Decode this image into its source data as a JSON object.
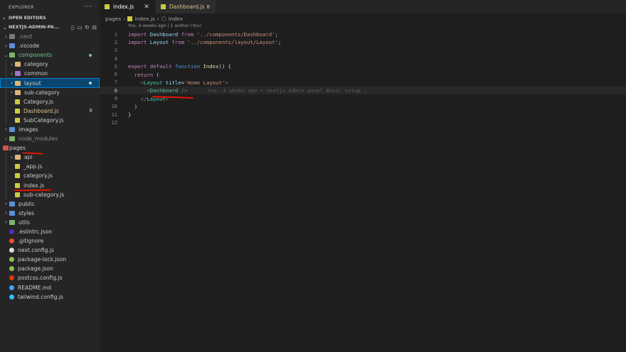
{
  "sidebar": {
    "title": "EXPLORER",
    "more": "···",
    "open_editors": "OPEN EDITORS",
    "project": "NEXTJS-ADMIN-PA...",
    "tree": [
      {
        "label": ".next",
        "twisty": "›",
        "icon": "folder-grey",
        "depth": 0,
        "style": "dim"
      },
      {
        "label": ".vscode",
        "twisty": "›",
        "icon": "folder-blue",
        "depth": 0
      },
      {
        "label": "components",
        "twisty": "⌄",
        "icon": "folder-green",
        "depth": 0,
        "style": "green",
        "dot": true
      },
      {
        "label": "category",
        "twisty": "›",
        "icon": "folder",
        "depth": 1
      },
      {
        "label": "common",
        "twisty": "›",
        "icon": "folder-purple",
        "depth": 1
      },
      {
        "label": "layout",
        "twisty": "›",
        "icon": "folder",
        "depth": 1,
        "selected": true,
        "dot": true
      },
      {
        "label": "sub-category",
        "twisty": "›",
        "icon": "folder",
        "depth": 1
      },
      {
        "label": "Category.js",
        "twisty": "",
        "icon": "js",
        "depth": 1
      },
      {
        "label": "Dashboard.js",
        "twisty": "",
        "icon": "js",
        "depth": 1,
        "style": "mod",
        "badge": "8"
      },
      {
        "label": "SubCategory.js",
        "twisty": "",
        "icon": "js",
        "depth": 1
      },
      {
        "label": "images",
        "twisty": "›",
        "icon": "folder-blue",
        "depth": 0
      },
      {
        "label": "node_modules",
        "twisty": "›",
        "icon": "folder-green",
        "depth": 0,
        "style": "dim"
      },
      {
        "label": "pages",
        "twisty": "⌄",
        "icon": "folder-red",
        "depth": 0
      },
      {
        "label": "api",
        "twisty": "›",
        "icon": "folder",
        "depth": 1
      },
      {
        "label": "_app.js",
        "twisty": "",
        "icon": "js",
        "depth": 1
      },
      {
        "label": "category.js",
        "twisty": "",
        "icon": "js",
        "depth": 1
      },
      {
        "label": "index.js",
        "twisty": "",
        "icon": "js",
        "depth": 1
      },
      {
        "label": "sub-category.js",
        "twisty": "",
        "icon": "js",
        "depth": 1
      },
      {
        "label": "public",
        "twisty": "›",
        "icon": "folder-blue",
        "depth": 0
      },
      {
        "label": "styles",
        "twisty": "›",
        "icon": "folder-blue",
        "depth": 0
      },
      {
        "label": "utils",
        "twisty": "›",
        "icon": "folder-green",
        "depth": 0
      },
      {
        "label": ".eslintrc.json",
        "twisty": "",
        "icon": "eslint",
        "depth": 0
      },
      {
        "label": ".gitignore",
        "twisty": "",
        "icon": "git",
        "depth": 0
      },
      {
        "label": "next.config.js",
        "twisty": "",
        "icon": "next",
        "depth": 0
      },
      {
        "label": "package-lock.json",
        "twisty": "",
        "icon": "npm",
        "depth": 0
      },
      {
        "label": "package.json",
        "twisty": "",
        "icon": "npm",
        "depth": 0
      },
      {
        "label": "postcss.config.js",
        "twisty": "",
        "icon": "postcss",
        "depth": 0
      },
      {
        "label": "README.md",
        "twisty": "",
        "icon": "info",
        "depth": 0
      },
      {
        "label": "tailwind.config.js",
        "twisty": "",
        "icon": "tailwind",
        "depth": 0
      }
    ]
  },
  "tabs": [
    {
      "label": "index.js",
      "close": "✕",
      "active": true
    },
    {
      "label": "Dashboard.js",
      "count": "8",
      "active": false
    }
  ],
  "breadcrumb": {
    "folder": "pages",
    "sep": "›",
    "file": "index.js",
    "symbol": "Index"
  },
  "codelens": "You, 4 weeks ago | 1 author (You)",
  "editor": {
    "lines": [
      {
        "n": "1",
        "tokens": [
          [
            "kw",
            "import"
          ],
          [
            "pl",
            " "
          ],
          [
            "id",
            "Dashboard"
          ],
          [
            "pl",
            " "
          ],
          [
            "kw",
            "from"
          ],
          [
            "pl",
            " "
          ],
          [
            "str",
            "'../components/Dashboard'"
          ],
          [
            "pl",
            ";"
          ]
        ]
      },
      {
        "n": "2",
        "tokens": [
          [
            "kw",
            "import"
          ],
          [
            "pl",
            " "
          ],
          [
            "id",
            "Layout"
          ],
          [
            "pl",
            " "
          ],
          [
            "kw",
            "from"
          ],
          [
            "pl",
            " "
          ],
          [
            "str",
            "'../components/layout/Layout'"
          ],
          [
            "pl",
            ";"
          ]
        ]
      },
      {
        "n": "3",
        "tokens": []
      },
      {
        "n": "4",
        "tokens": []
      },
      {
        "n": "5",
        "tokens": [
          [
            "kw",
            "export"
          ],
          [
            "pl",
            " "
          ],
          [
            "kw",
            "default"
          ],
          [
            "pl",
            " "
          ],
          [
            "kw2",
            "function"
          ],
          [
            "pl",
            " "
          ],
          [
            "fn",
            "Index"
          ],
          [
            "pl",
            "() {"
          ]
        ]
      },
      {
        "n": "6",
        "tokens": [
          [
            "pl",
            "  "
          ],
          [
            "kw",
            "return"
          ],
          [
            "pl",
            " ("
          ]
        ]
      },
      {
        "n": "7",
        "tokens": [
          [
            "pl",
            "    "
          ],
          [
            "tg",
            "<"
          ],
          [
            "cls",
            "Layout"
          ],
          [
            "pl",
            " "
          ],
          [
            "id",
            "title"
          ],
          [
            "pl",
            "="
          ],
          [
            "str",
            "'Home Layout'"
          ],
          [
            "tg",
            ">"
          ]
        ]
      },
      {
        "n": "8",
        "tokens": [
          [
            "pl",
            "      "
          ],
          [
            "tg",
            "<"
          ],
          [
            "cls",
            "Dashboard"
          ],
          [
            "pl",
            " "
          ],
          [
            "tg",
            "/>"
          ]
        ],
        "ghost": "You, 4 weeks ago • nextjs Admin panel Basic setup …",
        "current": true
      },
      {
        "n": "9",
        "tokens": [
          [
            "pl",
            "    "
          ],
          [
            "tg",
            "</"
          ],
          [
            "cls",
            "Layout"
          ],
          [
            "tg",
            ">"
          ]
        ]
      },
      {
        "n": "10",
        "tokens": [
          [
            "pl",
            "  )"
          ]
        ]
      },
      {
        "n": "11",
        "tokens": [
          [
            "pl",
            "}"
          ]
        ]
      },
      {
        "n": "12",
        "tokens": []
      }
    ]
  },
  "colors": {
    "accent": "#007fd4",
    "selection": "#094771",
    "annotation": "#e51400"
  }
}
